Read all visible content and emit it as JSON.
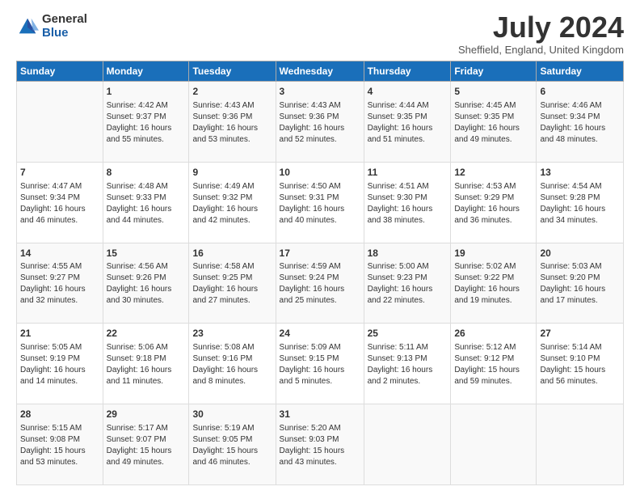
{
  "logo": {
    "general": "General",
    "blue": "Blue"
  },
  "title": "July 2024",
  "location": "Sheffield, England, United Kingdom",
  "days_of_week": [
    "Sunday",
    "Monday",
    "Tuesday",
    "Wednesday",
    "Thursday",
    "Friday",
    "Saturday"
  ],
  "weeks": [
    [
      {
        "day": "",
        "info": ""
      },
      {
        "day": "1",
        "info": "Sunrise: 4:42 AM\nSunset: 9:37 PM\nDaylight: 16 hours and 55 minutes."
      },
      {
        "day": "2",
        "info": "Sunrise: 4:43 AM\nSunset: 9:36 PM\nDaylight: 16 hours and 53 minutes."
      },
      {
        "day": "3",
        "info": "Sunrise: 4:43 AM\nSunset: 9:36 PM\nDaylight: 16 hours and 52 minutes."
      },
      {
        "day": "4",
        "info": "Sunrise: 4:44 AM\nSunset: 9:35 PM\nDaylight: 16 hours and 51 minutes."
      },
      {
        "day": "5",
        "info": "Sunrise: 4:45 AM\nSunset: 9:35 PM\nDaylight: 16 hours and 49 minutes."
      },
      {
        "day": "6",
        "info": "Sunrise: 4:46 AM\nSunset: 9:34 PM\nDaylight: 16 hours and 48 minutes."
      }
    ],
    [
      {
        "day": "7",
        "info": "Sunrise: 4:47 AM\nSunset: 9:34 PM\nDaylight: 16 hours and 46 minutes."
      },
      {
        "day": "8",
        "info": "Sunrise: 4:48 AM\nSunset: 9:33 PM\nDaylight: 16 hours and 44 minutes."
      },
      {
        "day": "9",
        "info": "Sunrise: 4:49 AM\nSunset: 9:32 PM\nDaylight: 16 hours and 42 minutes."
      },
      {
        "day": "10",
        "info": "Sunrise: 4:50 AM\nSunset: 9:31 PM\nDaylight: 16 hours and 40 minutes."
      },
      {
        "day": "11",
        "info": "Sunrise: 4:51 AM\nSunset: 9:30 PM\nDaylight: 16 hours and 38 minutes."
      },
      {
        "day": "12",
        "info": "Sunrise: 4:53 AM\nSunset: 9:29 PM\nDaylight: 16 hours and 36 minutes."
      },
      {
        "day": "13",
        "info": "Sunrise: 4:54 AM\nSunset: 9:28 PM\nDaylight: 16 hours and 34 minutes."
      }
    ],
    [
      {
        "day": "14",
        "info": "Sunrise: 4:55 AM\nSunset: 9:27 PM\nDaylight: 16 hours and 32 minutes."
      },
      {
        "day": "15",
        "info": "Sunrise: 4:56 AM\nSunset: 9:26 PM\nDaylight: 16 hours and 30 minutes."
      },
      {
        "day": "16",
        "info": "Sunrise: 4:58 AM\nSunset: 9:25 PM\nDaylight: 16 hours and 27 minutes."
      },
      {
        "day": "17",
        "info": "Sunrise: 4:59 AM\nSunset: 9:24 PM\nDaylight: 16 hours and 25 minutes."
      },
      {
        "day": "18",
        "info": "Sunrise: 5:00 AM\nSunset: 9:23 PM\nDaylight: 16 hours and 22 minutes."
      },
      {
        "day": "19",
        "info": "Sunrise: 5:02 AM\nSunset: 9:22 PM\nDaylight: 16 hours and 19 minutes."
      },
      {
        "day": "20",
        "info": "Sunrise: 5:03 AM\nSunset: 9:20 PM\nDaylight: 16 hours and 17 minutes."
      }
    ],
    [
      {
        "day": "21",
        "info": "Sunrise: 5:05 AM\nSunset: 9:19 PM\nDaylight: 16 hours and 14 minutes."
      },
      {
        "day": "22",
        "info": "Sunrise: 5:06 AM\nSunset: 9:18 PM\nDaylight: 16 hours and 11 minutes."
      },
      {
        "day": "23",
        "info": "Sunrise: 5:08 AM\nSunset: 9:16 PM\nDaylight: 16 hours and 8 minutes."
      },
      {
        "day": "24",
        "info": "Sunrise: 5:09 AM\nSunset: 9:15 PM\nDaylight: 16 hours and 5 minutes."
      },
      {
        "day": "25",
        "info": "Sunrise: 5:11 AM\nSunset: 9:13 PM\nDaylight: 16 hours and 2 minutes."
      },
      {
        "day": "26",
        "info": "Sunrise: 5:12 AM\nSunset: 9:12 PM\nDaylight: 15 hours and 59 minutes."
      },
      {
        "day": "27",
        "info": "Sunrise: 5:14 AM\nSunset: 9:10 PM\nDaylight: 15 hours and 56 minutes."
      }
    ],
    [
      {
        "day": "28",
        "info": "Sunrise: 5:15 AM\nSunset: 9:08 PM\nDaylight: 15 hours and 53 minutes."
      },
      {
        "day": "29",
        "info": "Sunrise: 5:17 AM\nSunset: 9:07 PM\nDaylight: 15 hours and 49 minutes."
      },
      {
        "day": "30",
        "info": "Sunrise: 5:19 AM\nSunset: 9:05 PM\nDaylight: 15 hours and 46 minutes."
      },
      {
        "day": "31",
        "info": "Sunrise: 5:20 AM\nSunset: 9:03 PM\nDaylight: 15 hours and 43 minutes."
      },
      {
        "day": "",
        "info": ""
      },
      {
        "day": "",
        "info": ""
      },
      {
        "day": "",
        "info": ""
      }
    ]
  ]
}
